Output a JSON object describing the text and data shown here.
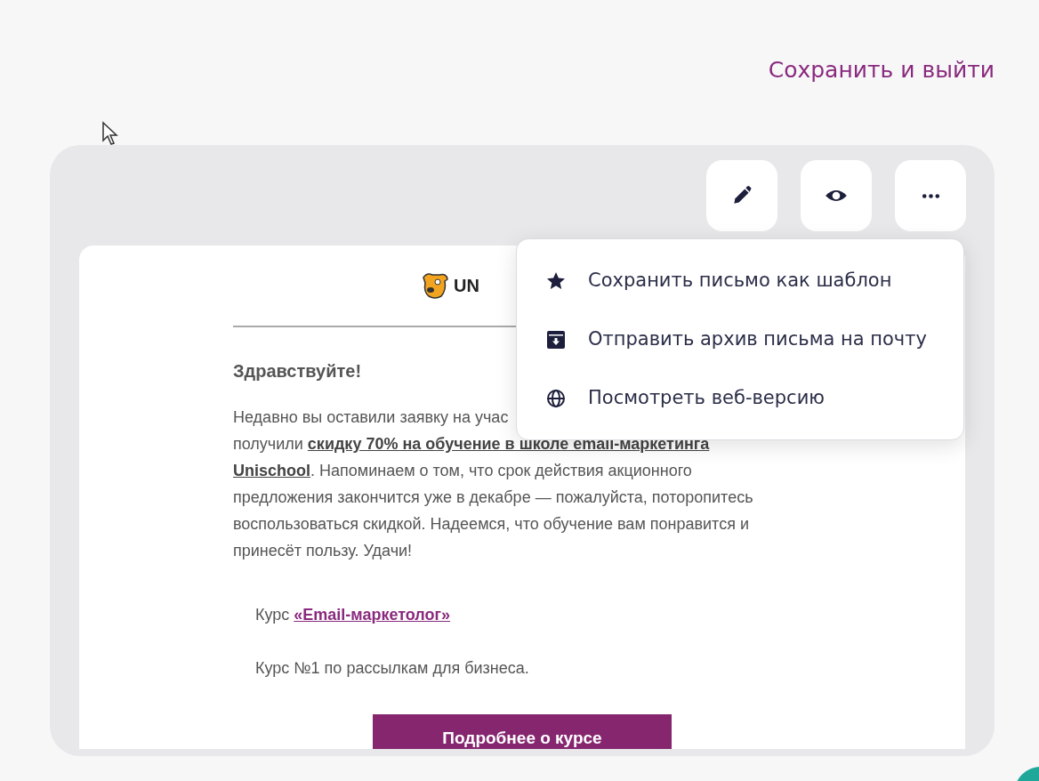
{
  "header": {
    "save_exit_link": "Сохранить и выйти"
  },
  "toolbar": [
    {
      "kind": "edit"
    },
    {
      "kind": "preview"
    },
    {
      "kind": "more"
    }
  ],
  "menu": {
    "items": [
      {
        "kind": "star",
        "label": "Сохранить письмо как шаблон"
      },
      {
        "kind": "archive",
        "label": "Отправить архив письма на почту"
      },
      {
        "kind": "globe",
        "label": "Посмотреть веб-версию"
      }
    ]
  },
  "email": {
    "logo_text": "UN",
    "greeting": "Здравствуйте!",
    "paragraph_lines": [
      "Недавно вы оставили заявку на учас",
      "получили **скидку 70% на обучение в школе email-маркетинга**",
      "**Unischool**. Напоминаем о том, что срок действия акционного",
      "предложения закончится уже в декабре — пожалуйста, поторопитесь",
      "воспользоваться скидкой. Надеемся, что обучение вам понравится и",
      "принесёт пользу. Удачи!"
    ],
    "course_label": "Курс",
    "course_link": "«Email-маркетолог»",
    "course_note": "Курс №1 по рассылкам для бизнеса.",
    "cta_button": "Подробнее о курсе"
  }
}
